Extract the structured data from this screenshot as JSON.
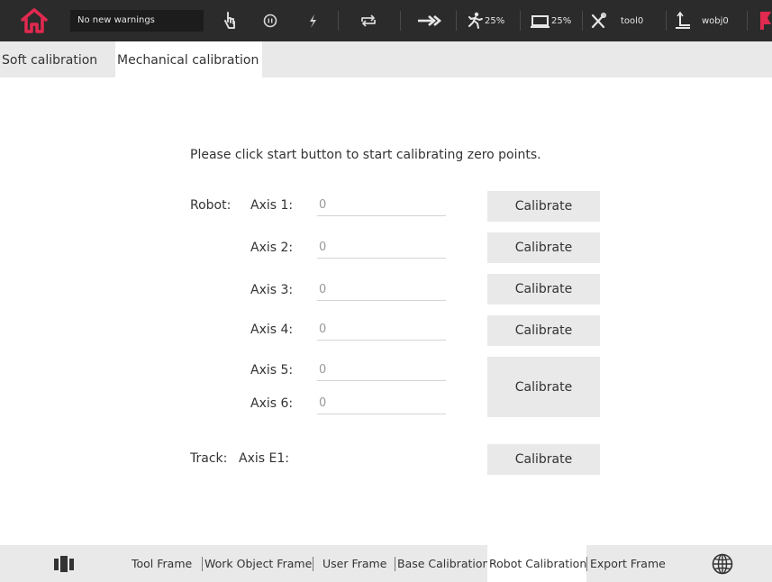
{
  "statusbar": {
    "warning_text": "No new warnings",
    "speed_run": "25%",
    "speed_screen": "25%",
    "tool": "tool0",
    "wobj": "wobj0",
    "colors": {
      "bar": "#2b2b2b",
      "brand": "#e2294f"
    },
    "icons": [
      "home-icon",
      "hand-icon",
      "pause-icon",
      "lightning-icon",
      "repeat-icon",
      "arrow-right-icon",
      "running-man-icon",
      "monitor-icon",
      "tools-icon",
      "work-object-icon",
      "red-flag-icon"
    ]
  },
  "tabs": [
    {
      "label": "Soft calibration",
      "active": false
    },
    {
      "label": "Mechanical calibration",
      "active": true
    }
  ],
  "main": {
    "intro": "Please click start button to start calibrating zero points.",
    "robot_label": "Robot:",
    "track_label": "Track:",
    "axes": [
      {
        "label": "Axis 1:",
        "value": "0"
      },
      {
        "label": "Axis 2:",
        "value": "0"
      },
      {
        "label": "Axis 3:",
        "value": "0"
      },
      {
        "label": "Axis 4:",
        "value": "0"
      },
      {
        "label": "Axis 5:",
        "value": "0"
      },
      {
        "label": "Axis 6:",
        "value": "0"
      }
    ],
    "track_axis": {
      "label": "Axis E1:"
    },
    "calibrate_label": "Calibrate"
  },
  "bottom_nav": {
    "items": [
      {
        "label": "Tool Frame",
        "active": false
      },
      {
        "label": "Work Object Frame",
        "active": false
      },
      {
        "label": "User Frame",
        "active": false
      },
      {
        "label": "Base Calibration",
        "active": false
      },
      {
        "label": "Robot Calibration",
        "active": true
      },
      {
        "label": "Export Frame",
        "active": false
      }
    ],
    "icons": [
      "bars-menu-icon",
      "globe-icon"
    ]
  }
}
